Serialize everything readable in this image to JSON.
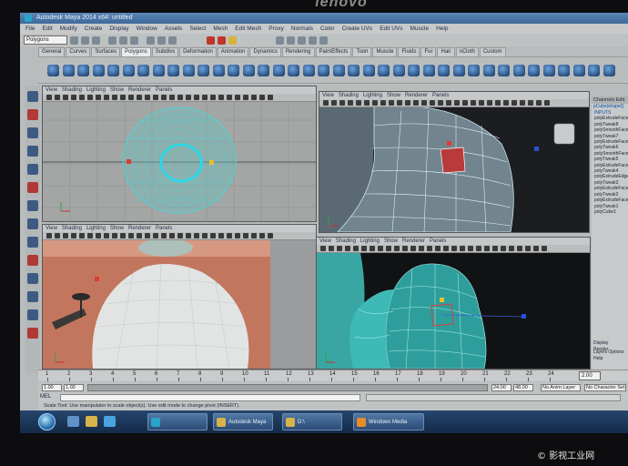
{
  "bezel": {
    "brand": "lenovo"
  },
  "window": {
    "title": "Autodesk Maya 2014 x64: untitled"
  },
  "menubar": [
    "File",
    "Edit",
    "Modify",
    "Create",
    "Display",
    "Window",
    "Assets",
    "Select",
    "Mesh",
    "Edit Mesh",
    "Proxy",
    "Normals",
    "Color",
    "Create UVs",
    "Edit UVs",
    "Muscle",
    "Help"
  ],
  "status": {
    "mode": "Polygons"
  },
  "shelf_tabs": [
    "General",
    "Curves",
    "Surfaces",
    "Polygons",
    "Subdivs",
    "Deformation",
    "Animation",
    "Dynamics",
    "Rendering",
    "PaintEffects",
    "Toon",
    "Muscle",
    "Fluids",
    "Fur",
    "Hair",
    "nCloth",
    "Custom"
  ],
  "shelf_active": "Polygons",
  "viewport_menu": [
    "View",
    "Shading",
    "Lighting",
    "Show",
    "Renderer",
    "Panels"
  ],
  "viewports": [
    {
      "name": "top-left",
      "content": "front view wireframe"
    },
    {
      "name": "top-right",
      "content": "perspective close-up"
    },
    {
      "name": "bottom-left",
      "content": "image-plane reference"
    },
    {
      "name": "bottom-right",
      "content": "perspective smooth"
    }
  ],
  "viewport_labels": {
    "front": "front",
    "persp": "persp"
  },
  "channel_box": {
    "header": "Channels  Edit",
    "selected": "pCube|shapeQ",
    "inputs_label": "INPUTS",
    "items": [
      "polyExtrudeFace",
      "polyTweak8",
      "polySmoothFace",
      "polyTweak7",
      "polyExtrudeFace",
      "polyTweak6",
      "polySmoothFace",
      "polyTweak5",
      "polyExtrudeFace",
      "polyTweak4",
      "polyExtrudeEdge",
      "polyTweak3",
      "polyExtrudeFace",
      "polyTweak2",
      "polyExtrudeFace",
      "polyTweak1",
      "polyCube1"
    ],
    "footer_tabs": [
      "Display",
      "Render"
    ],
    "footer_menu": [
      "Layers",
      "Options",
      "Help"
    ]
  },
  "timeline": {
    "frames": [
      1,
      2,
      3,
      4,
      5,
      6,
      7,
      8,
      9,
      10,
      11,
      12,
      13,
      14,
      15,
      16,
      17,
      18,
      19,
      20,
      21,
      22,
      23,
      24
    ],
    "current": "2.00"
  },
  "range": {
    "start": "1.00",
    "inner_start": "1.00",
    "inner_end": "24.00",
    "end": "48.00",
    "anim_layer": "No Anim Layer",
    "char_set": "No Character Set"
  },
  "command": {
    "lang": "MEL"
  },
  "helpline": "Scale Tool: Use manipulator to scale object(s). Use edit mode to change pivot (INSERT).",
  "taskbar": {
    "tasks": [
      {
        "label": ""
      },
      {
        "label": "Autodesk Maya"
      },
      {
        "label": "D:\\"
      },
      {
        "label": "Windows Media"
      }
    ]
  },
  "watermark": "影视工业网"
}
